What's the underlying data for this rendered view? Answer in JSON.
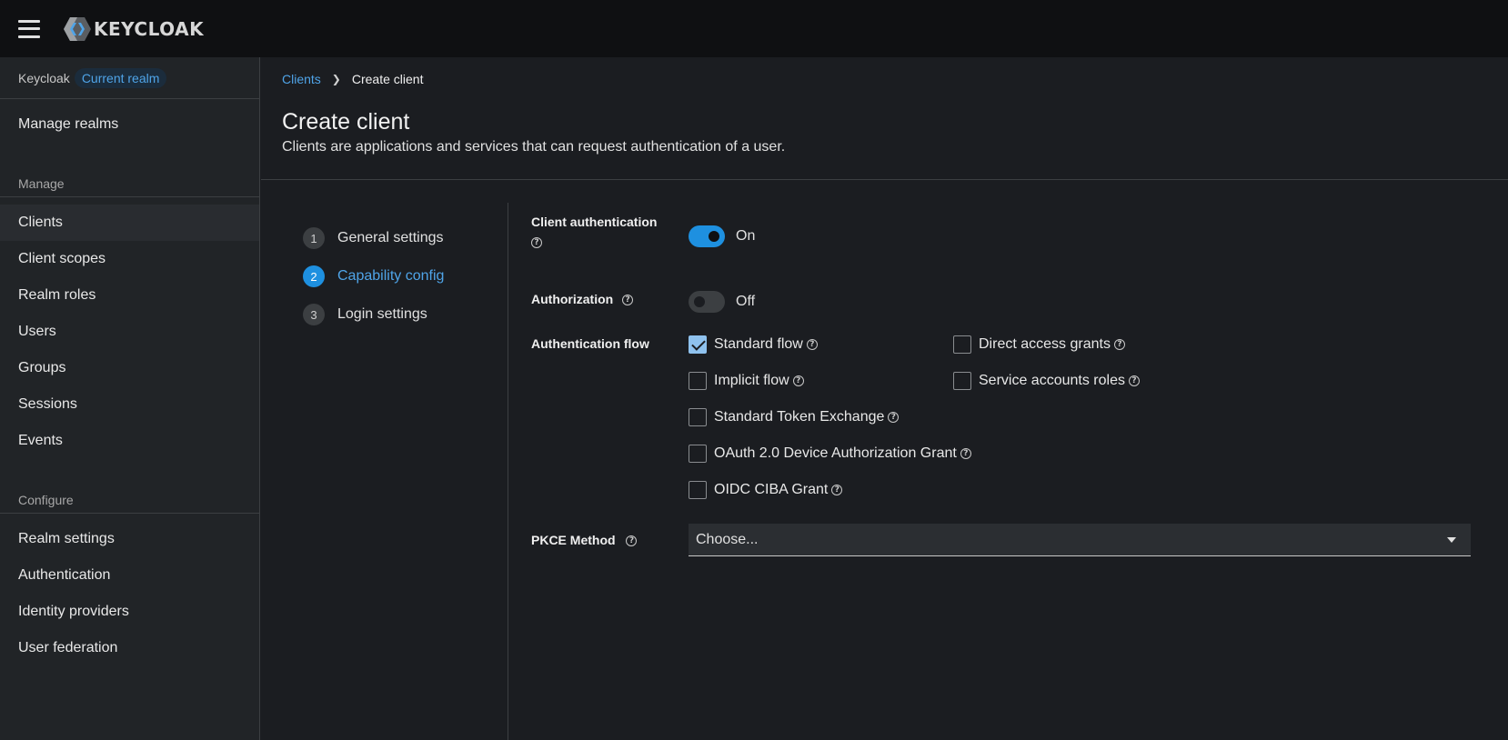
{
  "app": {
    "logo_text": "KEYCLOAK",
    "logo_color": "#4fa4e8"
  },
  "sidebar": {
    "realm_label": "Keycloak",
    "realm_badge": "Current realm",
    "manage_realms": "Manage realms",
    "manage_section": "Manage",
    "manage_items": [
      "Clients",
      "Client scopes",
      "Realm roles",
      "Users",
      "Groups",
      "Sessions",
      "Events"
    ],
    "configure_section": "Configure",
    "configure_items": [
      "Realm settings",
      "Authentication",
      "Identity providers",
      "User federation"
    ],
    "active_item": "Clients"
  },
  "breadcrumb": {
    "parent": "Clients",
    "current": "Create client"
  },
  "page": {
    "title": "Create client",
    "description": "Clients are applications and services that can request authentication of a user."
  },
  "wizard": {
    "steps": [
      {
        "number": "1",
        "label": "General settings"
      },
      {
        "number": "2",
        "label": "Capability config"
      },
      {
        "number": "3",
        "label": "Login settings"
      }
    ],
    "current_step": 2
  },
  "form": {
    "client_auth": {
      "label": "Client authentication",
      "state": "On"
    },
    "authorization": {
      "label": "Authorization",
      "state": "Off"
    },
    "auth_flow": {
      "label": "Authentication flow",
      "options": [
        {
          "label": "Standard flow",
          "checked": true
        },
        {
          "label": "Direct access grants",
          "checked": false
        },
        {
          "label": "Implicit flow",
          "checked": false
        },
        {
          "label": "Service accounts roles",
          "checked": false
        },
        {
          "label": "Standard Token Exchange",
          "checked": false
        },
        {
          "label": "OAuth 2.0 Device Authorization Grant",
          "checked": false
        },
        {
          "label": "OIDC CIBA Grant",
          "checked": false
        }
      ]
    },
    "pkce": {
      "label": "PKCE Method",
      "value": "Choose..."
    },
    "help_glyph": "?"
  }
}
